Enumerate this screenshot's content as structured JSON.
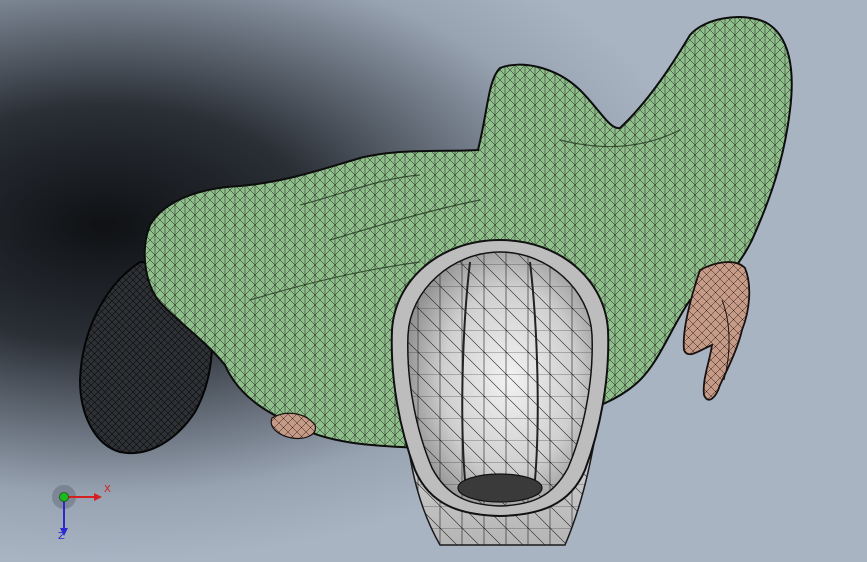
{
  "triad": {
    "x_label": "X",
    "z_label": "Z",
    "x_color": "#d42020",
    "y_color": "#1fb81f",
    "z_color": "#2a2ad0"
  },
  "colors": {
    "body_mesh": "#8fbf8a",
    "skin_mesh": "#c59a86",
    "helmet_mesh": "#c8c8c8",
    "leg_mesh": "#2a2d30",
    "wire": "#111111"
  }
}
